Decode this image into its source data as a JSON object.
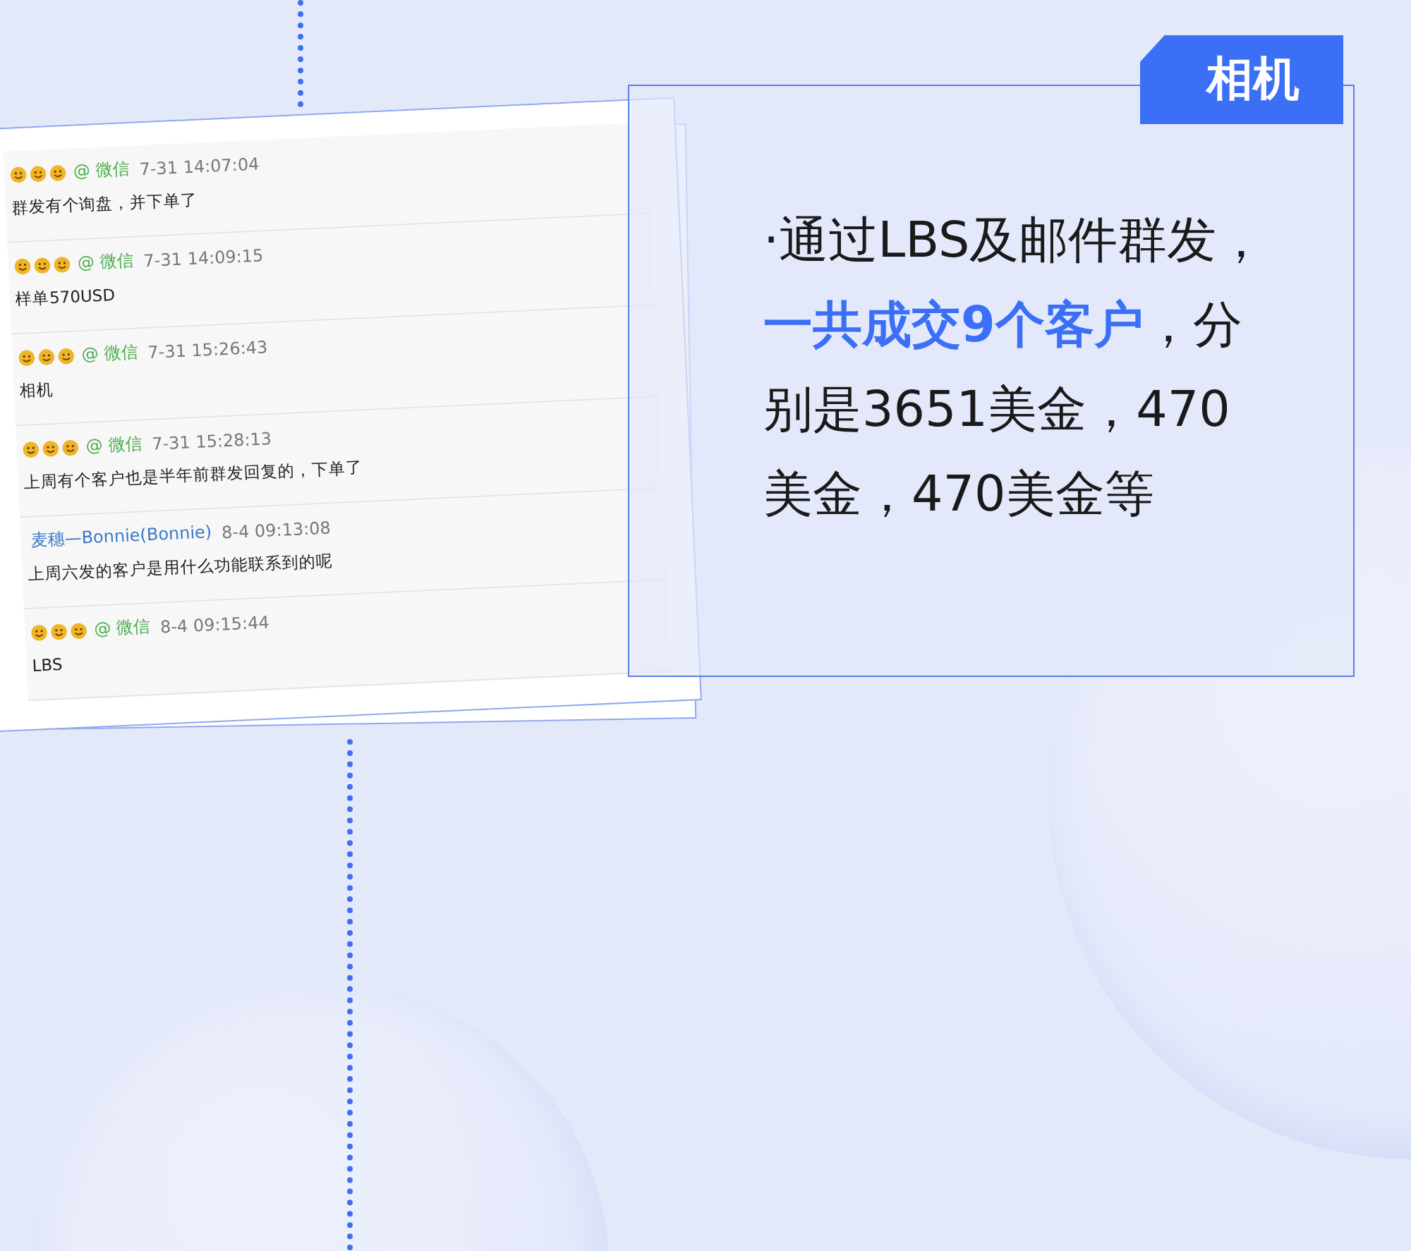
{
  "chat": {
    "messages": [
      {
        "kind": "wechat",
        "sender": "@ 微信",
        "time": "7-31 14:07:04",
        "text": "群发有个询盘，并下单了"
      },
      {
        "kind": "wechat",
        "sender": "@ 微信",
        "time": "7-31 14:09:15",
        "text": "样单570USD"
      },
      {
        "kind": "wechat",
        "sender": "@ 微信",
        "time": "7-31 15:26:43",
        "text": "相机"
      },
      {
        "kind": "wechat",
        "sender": "@ 微信",
        "time": "7-31 15:28:13",
        "text": "上周有个客户也是半年前群发回复的，下单了"
      },
      {
        "kind": "named",
        "sender": "麦穗—Bonnie(Bonnie)",
        "time": "8-4 09:13:08",
        "text": "上周六发的客户是用什么功能联系到的呢"
      },
      {
        "kind": "wechat",
        "sender": "@ 微信",
        "time": "8-4 09:15:44",
        "text": "LBS"
      }
    ]
  },
  "card": {
    "tag": "相机",
    "segments": [
      {
        "text": "·通过LBS及邮件群发，",
        "highlight": false
      },
      {
        "text": "一共成交9个客户",
        "highlight": true
      },
      {
        "text": "，分别是3651美金，470美金，470美金等",
        "highlight": false
      }
    ]
  }
}
